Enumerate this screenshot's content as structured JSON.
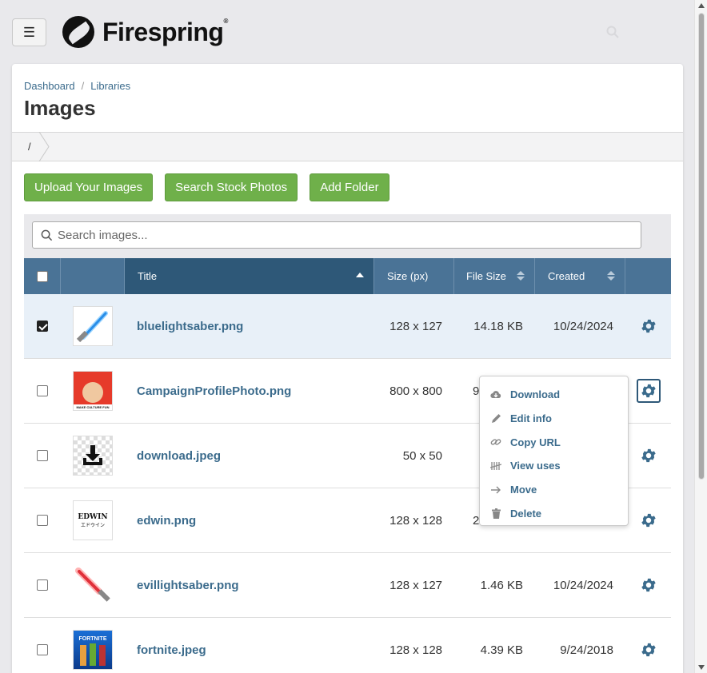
{
  "header": {
    "menu_icon": "hamburger-icon",
    "logo_text": "Firespring",
    "logo_mark": "®"
  },
  "breadcrumb": {
    "items": [
      "Dashboard",
      "Libraries"
    ],
    "separator": "/"
  },
  "page": {
    "title": "Images"
  },
  "path": {
    "root": "/"
  },
  "toolbar": {
    "upload_label": "Upload Your Images",
    "stock_label": "Search Stock Photos",
    "folder_label": "Add Folder"
  },
  "search": {
    "placeholder": "Search images...",
    "value": ""
  },
  "table": {
    "columns": {
      "title": "Title",
      "size": "Size (px)",
      "file_size": "File Size",
      "created": "Created"
    },
    "rows": [
      {
        "title": "bluelightsaber.png",
        "size": "128 x 127",
        "file_size": "14.18 KB",
        "created": "10/24/2024",
        "checked": true
      },
      {
        "title": "CampaignProfilePhoto.png",
        "size": "800 x 800",
        "file_size": "9",
        "created": "",
        "checked": false
      },
      {
        "title": "download.jpeg",
        "size": "50 x 50",
        "file_size": "",
        "created": "",
        "checked": false
      },
      {
        "title": "edwin.png",
        "size": "128 x 128",
        "file_size": "2",
        "created": "",
        "checked": false
      },
      {
        "title": "evillightsaber.png",
        "size": "128 x 127",
        "file_size": "1.46 KB",
        "created": "10/24/2024",
        "checked": false
      },
      {
        "title": "fortnite.jpeg",
        "size": "128 x 128",
        "file_size": "4.39 KB",
        "created": "9/24/2018",
        "checked": false
      }
    ]
  },
  "thumbs": {
    "edwin_text": "EDWIN",
    "edwin_sub": "エドウイン",
    "campaign_caption": "MAKE CULTURE FUN"
  },
  "menu": {
    "items": [
      "Download",
      "Edit info",
      "Copy URL",
      "View uses",
      "Move",
      "Delete"
    ]
  },
  "colors": {
    "accent": "#4a7396",
    "accent_dark": "#2e5878",
    "button_green": "#6fb04a",
    "link": "#3b6b8c"
  }
}
